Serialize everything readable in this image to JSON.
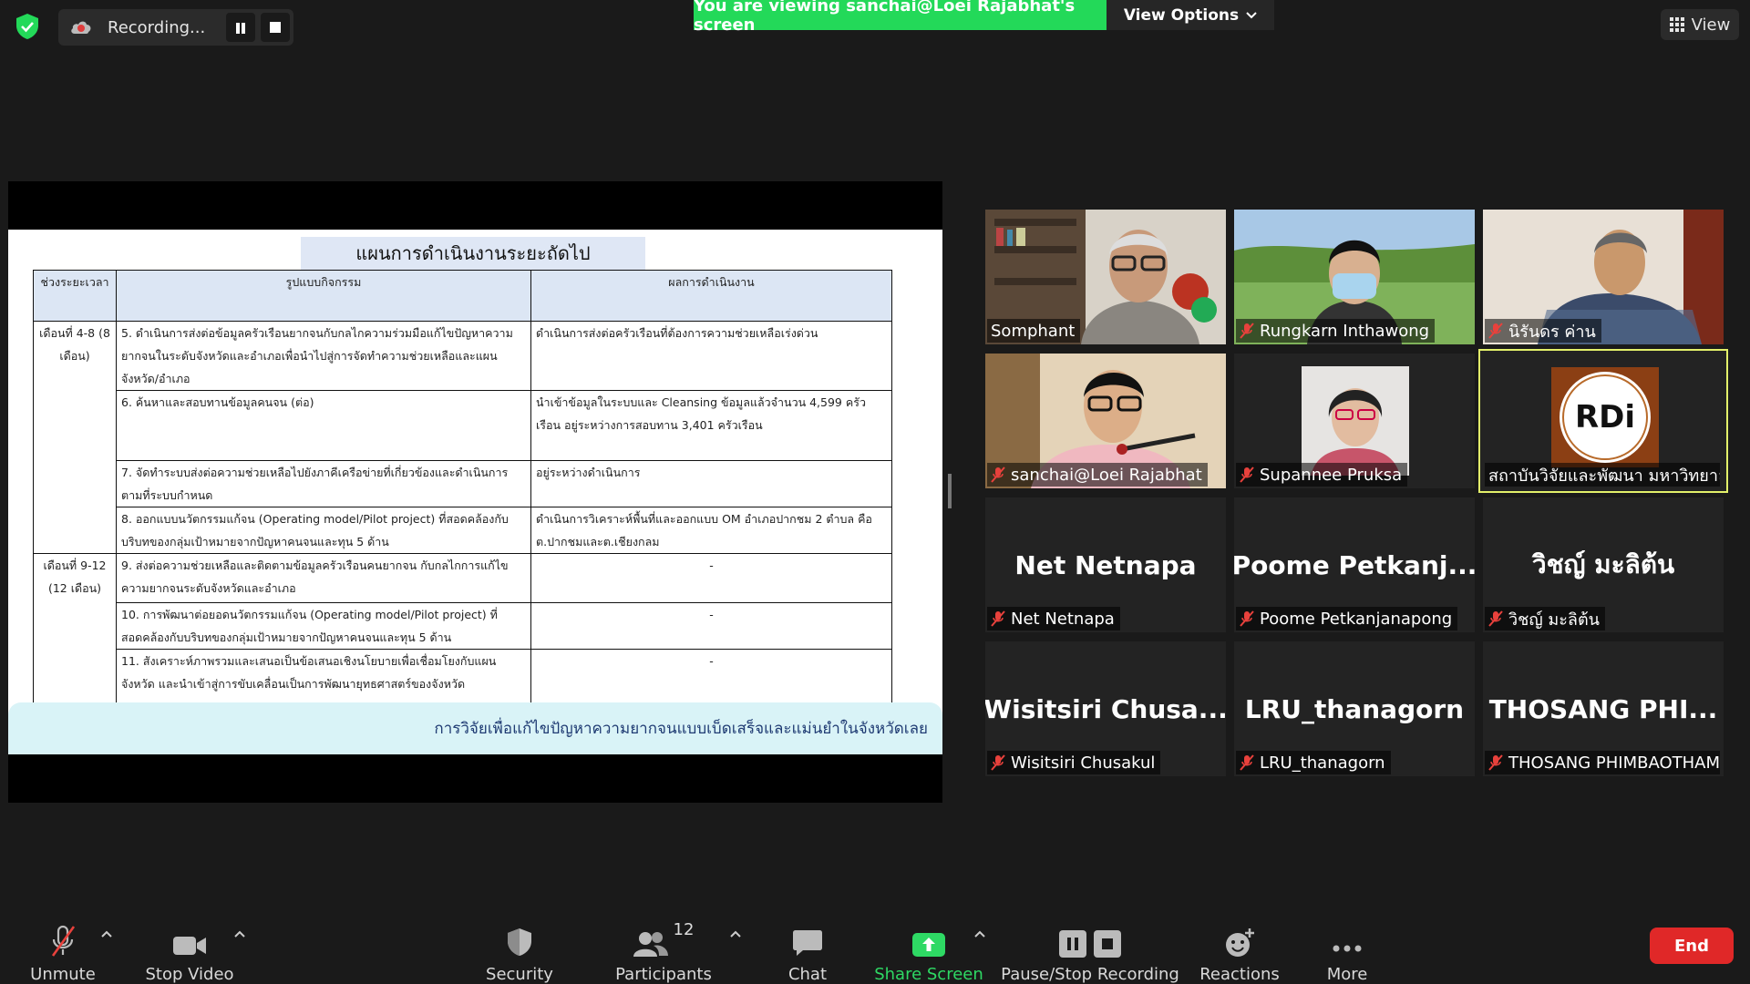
{
  "top": {
    "recording_label": "Recording...",
    "viewing_banner": "You are viewing sanchai@Loei Rajabhat's screen",
    "view_options_label": "View Options",
    "view_label": "View"
  },
  "slide": {
    "title": "แผนการดำเนินงานระยะถัดไป",
    "headers": [
      "ช่วงระยะเวลา",
      "รูปแบบกิจกรรม",
      "ผลการดำเนินงาน"
    ],
    "rows": [
      {
        "period": "เดือนที่ 4-8 (8 เดือน)",
        "activity": "5. ดำเนินการส่งต่อข้อมูลครัวเรือนยากจนกับกลไกความร่วมมือแก้ไขปัญหาความ ยากจนในระดับจังหวัดและอำเภอเพื่อนำไปสู่การจัดทำความช่วยเหลือและแผนจังหวัด/อำเภอ",
        "result": "ดำเนินการส่งต่อครัวเรือนที่ต้องการความช่วยเหลือเร่งด่วน"
      },
      {
        "period": "",
        "activity": "6. ค้นหาและสอบทานข้อมูลคนจน (ต่อ)",
        "result": "นำเข้าข้อมูลในระบบและ Cleansing ข้อมูลแล้วจำนวน 4,599 ครัวเรือน อยู่ระหว่างการสอบทาน 3,401 ครัวเรือน"
      },
      {
        "period": "",
        "activity": "7. จัดทำระบบส่งต่อความช่วยเหลือไปยังภาคีเครือข่ายที่เกี่ยวข้องและดำเนินการตามที่ระบบกำหนด",
        "result": "อยู่ระหว่างดำเนินการ"
      },
      {
        "period": "",
        "activity": "8. ออกแบบนวัตกรรมแก้จน (Operating model/Pilot project) ที่สอดคล้องกับบริบทของกลุ่มเป้าหมายจากปัญหาคนจนและทุน 5 ด้าน",
        "result": "ดำเนินการวิเคราะห์พื้นที่และออกแบบ OM อำเภอปากชม 2 ตำบล คือ ต.ปากชมและต.เชียงกลม"
      },
      {
        "period": "เดือนที่ 9-12 (12 เดือน)",
        "activity": "9. ส่งต่อความช่วยเหลือและติดตามข้อมูลครัวเรือนคนยากจน กับกลไกการแก้ไขความยากจนระดับจังหวัดและอำเภอ",
        "result": "-"
      },
      {
        "period": "",
        "activity": "10. การพัฒนาต่อยอดนวัตกรรมแก้จน (Operating model/Pilot project) ที่สอดคล้องกับบริบทของกลุ่มเป้าหมายจากปัญหาคนจนและทุน 5 ด้าน",
        "result": "-"
      },
      {
        "period": "",
        "activity": "11. สังเคราะห์ภาพรวมและเสนอเป็นข้อเสนอเชิงนโยบายเพื่อเชื่อมโยงกับแผนจังหวัด และนำเข้าสู่การขับเคลื่อนเป็นการพัฒนายุทธศาสตร์ของจังหวัด",
        "result": "-"
      }
    ],
    "footer": "การวิจัยเพื่อแก้ไขปัญหาความยากจนแบบเบ็ดเสร็จและแม่นยำในจังหวัดเลย"
  },
  "participants": [
    {
      "name": "Somphant",
      "muted": false,
      "video": true
    },
    {
      "name": "Rungkarn Inthawong",
      "muted": true,
      "video": true
    },
    {
      "name": "นิรันดร ค่าน",
      "muted": true,
      "video": true
    },
    {
      "name": "sanchai@Loei Rajabhat",
      "muted": true,
      "video": true
    },
    {
      "name": "Supannee Pruksa",
      "muted": true,
      "video": true
    },
    {
      "name": "สถาบันวิจัยและพัฒนา มหาวิทยาลั...",
      "muted": false,
      "video": true,
      "logo_text": "RDi"
    },
    {
      "name": "Net Netnapa",
      "display": "Net Netnapa",
      "muted": true,
      "video": false
    },
    {
      "name": "Poome Petkanjanapong",
      "display": "Poome  Petkanj...",
      "muted": true,
      "video": false
    },
    {
      "name": "วิชญ์ มะลิต้น",
      "display": "วิชญ์  มะลิต้น",
      "muted": true,
      "video": false
    },
    {
      "name": "Wisitsiri  Chusakul",
      "display": "Wisitsiri   Chusa...",
      "muted": true,
      "video": false
    },
    {
      "name": "LRU_thanagorn",
      "display": "LRU_thanagorn",
      "muted": true,
      "video": false
    },
    {
      "name": "THOSANG PHIMBAOTHAM",
      "display": "THOSANG  PHI...",
      "muted": true,
      "video": false
    }
  ],
  "toolbar": {
    "unmute": "Unmute",
    "stop_video": "Stop Video",
    "security": "Security",
    "participants": "Participants",
    "participant_count": "12",
    "chat": "Chat",
    "share_screen": "Share Screen",
    "pause_stop_recording": "Pause/Stop Recording",
    "reactions": "Reactions",
    "more": "More",
    "end": "End"
  },
  "colors": {
    "banner_green": "#23d959",
    "end_red": "#e02828",
    "share_green": "#2ed964",
    "active_speaker": "#e3f06a",
    "mute_red": "#e8413c"
  }
}
